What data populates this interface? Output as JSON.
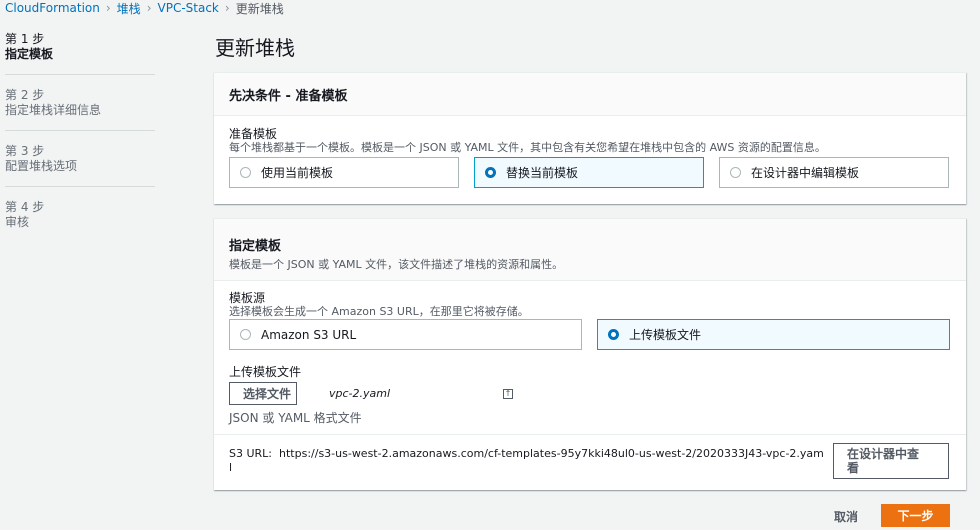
{
  "breadcrumb": {
    "items": [
      "CloudFormation",
      "堆栈",
      "VPC-Stack"
    ],
    "current": "更新堆栈",
    "separator": "›"
  },
  "steps": [
    {
      "num": "第 1 步",
      "name": "指定模板"
    },
    {
      "num": "第 2 步",
      "name": "指定堆栈详细信息"
    },
    {
      "num": "第 3 步",
      "name": "配置堆栈选项"
    },
    {
      "num": "第 4 步",
      "name": "审核"
    }
  ],
  "page_title": "更新堆栈",
  "prereq": {
    "title": "先决条件 - 准备模板",
    "field_label": "准备模板",
    "field_desc": "每个堆栈都基于一个模板。模板是一个 JSON 或 YAML 文件，其中包含有关您希望在堆栈中包含的 AWS 资源的配置信息。",
    "options": [
      "使用当前模板",
      "替换当前模板",
      "在设计器中编辑模板"
    ],
    "selected": "替换当前模板"
  },
  "template": {
    "title": "指定模板",
    "desc": "模板是一个 JSON 或 YAML 文件，该文件描述了堆栈的资源和属性。",
    "source_label": "模板源",
    "source_desc": "选择模板会生成一个 Amazon S3 URL，在那里它将被存储。",
    "source_options": [
      "Amazon S3 URL",
      "上传模板文件"
    ],
    "source_selected": "上传模板文件",
    "upload_label": "上传模板文件",
    "choose_file_label": "选择文件",
    "file_name": "vpc-2.yaml",
    "file_hint": "JSON 或 YAML 格式文件",
    "s3_url_prefix": "S3 URL:",
    "s3_url_line1": "https://s3-us-west-2.amazonaws.com/cf-templates-95y7kki48ul0-us-west-2/2020333J43-vpc-2.yam",
    "s3_url_line2": "l",
    "view_designer_line1": "在设计器中查",
    "view_designer_line2": "看"
  },
  "footer": {
    "cancel": "取消",
    "next": "下一步"
  },
  "colors": {
    "link": "#0073bb",
    "primary": "#ec7211",
    "selected_border": "#00a1c9",
    "selected_bg": "#f1faff"
  }
}
